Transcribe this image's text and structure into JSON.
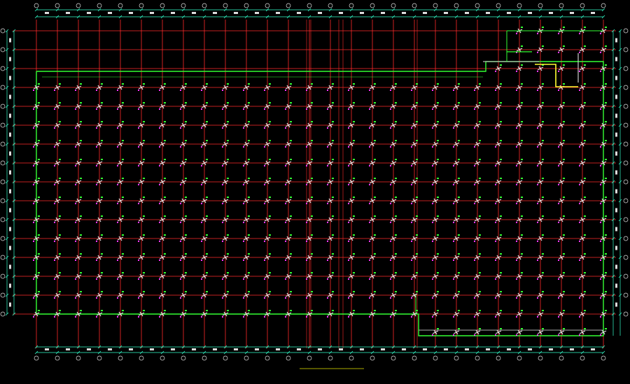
{
  "drawing": {
    "title": "",
    "subtitle": "",
    "colors": {
      "background": "#000000",
      "grid": "#ff2a2a",
      "outline": "#33ff33",
      "dimension": "#33ffcc",
      "pile": "#e0e0e0",
      "accent_magenta": "#ff33ff",
      "highlight": "#ffff33",
      "caption_title": "#e6e600",
      "caption_sub": "#33d7ff"
    },
    "grid_counts": {
      "vertical_axes": 28,
      "horizontal_axes": 16
    }
  }
}
